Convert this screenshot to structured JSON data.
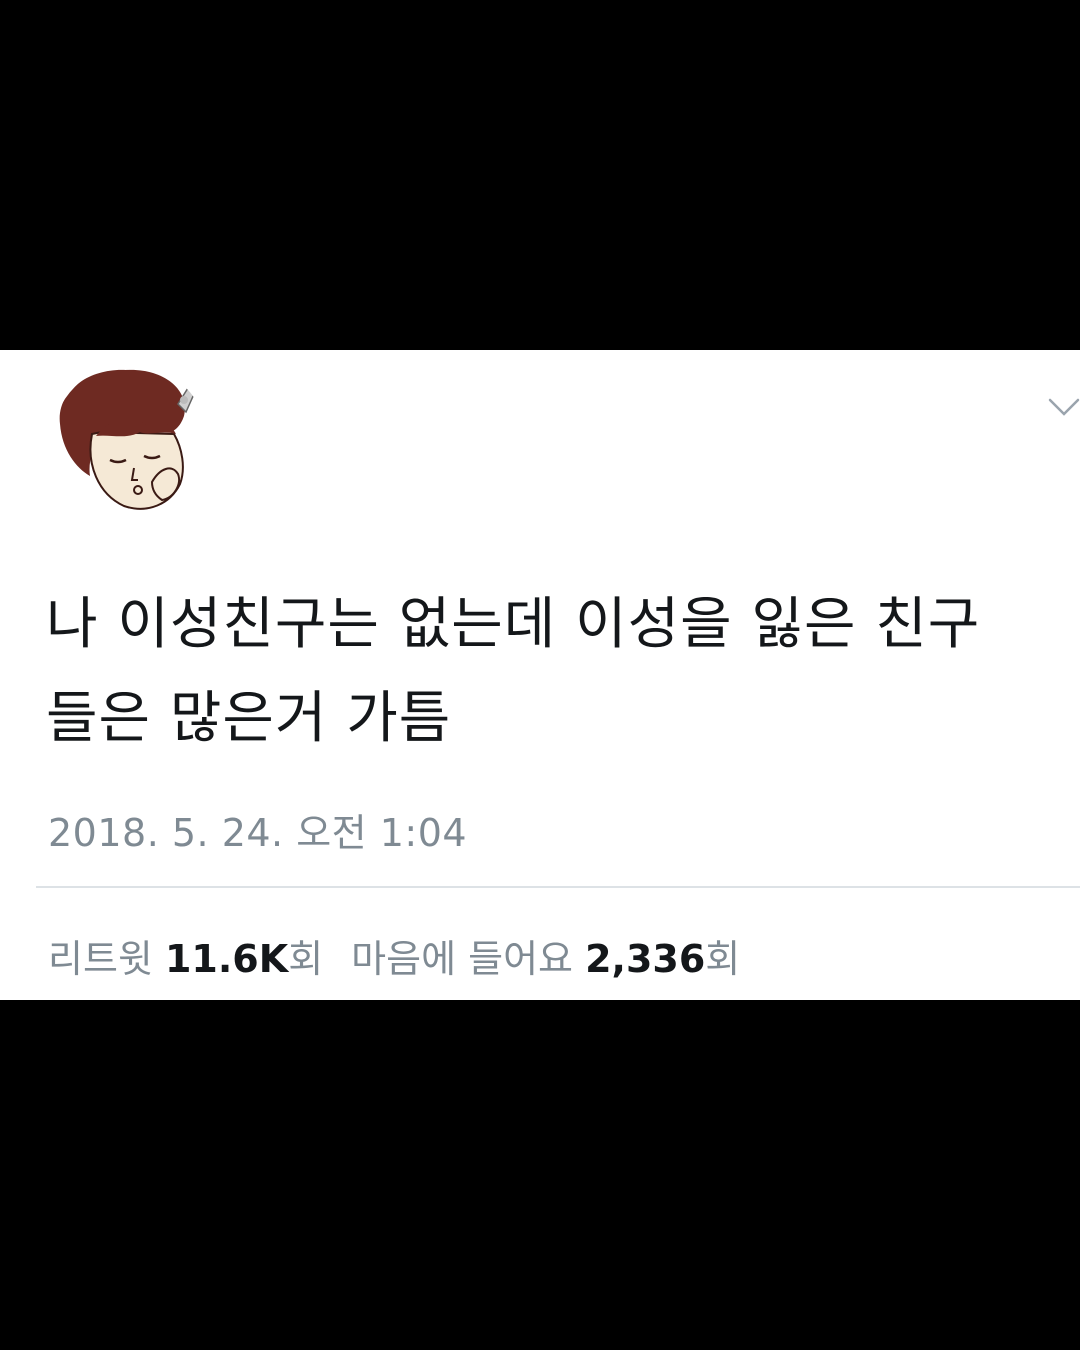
{
  "tweet": {
    "author_name": "",
    "author_handle": "",
    "avatar_icon": "cartoon-avatar-icon",
    "menu_icon": "chevron-down-icon",
    "text": "나 이성친구는 없는데 이성을 잃은 친구\n들은 많은거 가틈",
    "timestamp": "2018. 5. 24. 오전 1:04"
  },
  "stats": {
    "retweet_label": "리트윗",
    "retweet_count": "11.6K",
    "retweet_suffix": "회",
    "like_label": "마음에 들어요",
    "like_count": "2,336",
    "like_suffix": "회"
  },
  "colors": {
    "background": "#000000",
    "card": "#ffffff",
    "text": "#14171a",
    "muted": "#7f8a93",
    "divider": "#dde2e6",
    "hair": "#6e2a22"
  }
}
